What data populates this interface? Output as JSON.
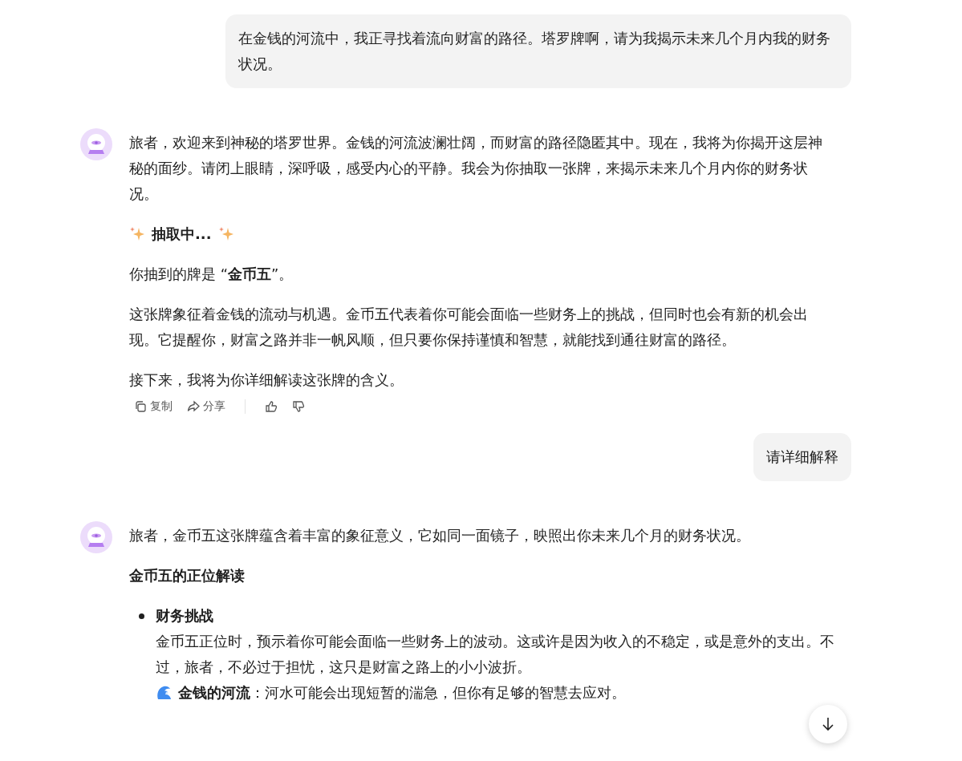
{
  "messages": [
    {
      "kind": "user",
      "text": "在金钱的河流中，我正寻找着流向财富的路径。塔罗牌啊，请为我揭示未来几个月内我的财务状况。"
    },
    {
      "kind": "assistant",
      "blocks": [
        {
          "kind": "paragraph",
          "text": "旅者，欢迎来到神秘的塔罗世界。金钱的河流波澜壮阔，而财富的路径隐匿其中。现在，我将为你揭开这层神秘的面纱。请闭上眼睛，深呼吸，感受内心的平静。我会为你抽取一张牌，来揭示未来几个月内你的财务状况。"
        },
        {
          "kind": "sparkle_heading",
          "text": "抽取中..."
        },
        {
          "kind": "paragraph",
          "text": "你抽到的牌是 “**金币五**”。"
        },
        {
          "kind": "paragraph",
          "text": "这张牌象征着金钱的流动与机遇。金币五代表着你可能会面临一些财务上的挑战，但同时也会有新的机会出现。它提醒你，财富之路并非一帆风顺，但只要你保持谨慎和智慧，就能找到通往财富的路径。"
        },
        {
          "kind": "paragraph",
          "text": "接下来，我将为你详细解读这张牌的含义。"
        }
      ],
      "actions": [
        {
          "kind": "copy",
          "label": "复制"
        },
        {
          "kind": "share",
          "label": "分享"
        },
        {
          "kind": "like"
        },
        {
          "kind": "dislike"
        }
      ]
    },
    {
      "kind": "user",
      "text": "请详细解释"
    },
    {
      "kind": "assistant",
      "blocks": [
        {
          "kind": "paragraph",
          "text": "旅者，金币五这张牌蕴含着丰富的象征意义，它如同一面镜子，映照出你未来几个月的财务状况。"
        },
        {
          "kind": "heading",
          "text": "金币五的正位解读"
        },
        {
          "kind": "bullet",
          "title": "财务挑战",
          "text": "金币五正位时，预示着你可能会面临一些财务上的波动。这或许是因为收入的不稳定，或是意外的支出。不过，旅者，不必过于担忧，这只是财富之路上的小小波折。",
          "note": "**金钱的河流**：河水可能会出现短暂的湍急，但你有足够的智慧去应对。"
        }
      ]
    }
  ]
}
